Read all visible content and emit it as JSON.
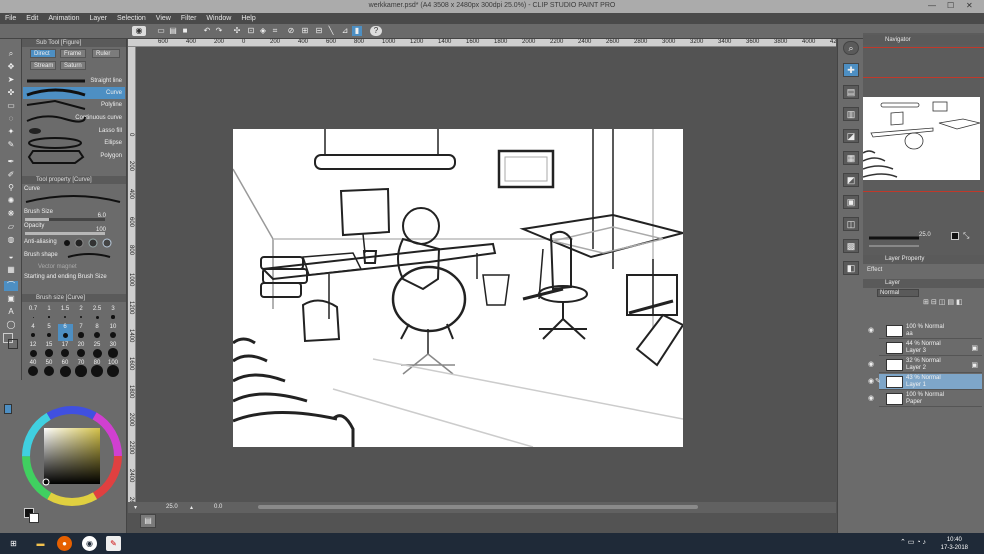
{
  "window": {
    "title": "werkkamer.psd* (A4 3508 x 2480px 300dpi 25.0%) - CLIP STUDIO PAINT PRO",
    "minimize": "—",
    "maximize": "☐",
    "close": "✕"
  },
  "menu": [
    "File",
    "Edit",
    "Animation",
    "Layer",
    "Selection",
    "View",
    "Filter",
    "Window",
    "Help"
  ],
  "ruler": {
    "h_ticks": [
      "600",
      "400",
      "200",
      "0",
      "200",
      "400",
      "600",
      "800",
      "1000",
      "1200",
      "1400",
      "1600",
      "1800",
      "2000",
      "2200",
      "2400",
      "2600",
      "2800",
      "3000",
      "3200",
      "3400",
      "3600",
      "3800",
      "4000",
      "4200"
    ],
    "v_ticks": [
      "0",
      "200",
      "400",
      "600",
      "800",
      "1000",
      "1200",
      "1400",
      "1600",
      "1800",
      "2000",
      "2200",
      "2400",
      "2600"
    ]
  },
  "subtool": {
    "header": "Sub Tool [Figure]",
    "tabs": [
      "Direct",
      "Frame",
      "Ruler",
      "Stream",
      "Saturn"
    ],
    "brushes": [
      "Straight line",
      "Curve",
      "Polyline",
      "Continuous curve",
      "Lasso fill",
      "Ellipse",
      "Polygon"
    ],
    "selected": "Curve"
  },
  "toolprop": {
    "header": "Tool property [Curve]",
    "name": "Curve",
    "brush_size_label": "Brush Size",
    "brush_size_value": "6.0",
    "brush_size_level": 0.3,
    "opacity_label": "Opacity",
    "opacity_value": "100",
    "opacity_level": 1.0,
    "antialiasing_label": "Anti-aliasing",
    "brush_shape_label": "Brush shape",
    "vector_label": "Vector magnet",
    "start_end_label": "Starting and ending",
    "start_end_value": "Brush Size"
  },
  "brushsize": {
    "header": "Brush size [Curve]",
    "sizes": [
      "0.7",
      "1",
      "1.5",
      "2",
      "2.5",
      "3",
      "4",
      "5",
      "6",
      "7",
      "8",
      "10",
      "12",
      "15",
      "17",
      "20",
      "25",
      "30",
      "40",
      "50",
      "60",
      "70",
      "80",
      "100"
    ]
  },
  "colors": {
    "main": "#111111",
    "sub": "#ffffff",
    "picker_hue": "#cfc25a",
    "accent": "#4d8fc3"
  },
  "statusbar": {
    "zoom": "25.0",
    "rotation": "0.0"
  },
  "navigator": {
    "tab": "Navigator"
  },
  "stroke_preview": {
    "value": "25.0"
  },
  "layer_property": {
    "tab": "Layer Property",
    "effect_label": "Effect"
  },
  "layers_panel": {
    "tab": "Layer",
    "blend": "Normal",
    "layers": [
      {
        "name": "aa",
        "mode": "100 % Normal",
        "locked": true
      },
      {
        "name": "Layer 3",
        "mode": "44 % Normal",
        "locked": true
      },
      {
        "name": "Layer 2",
        "mode": "32 % Normal",
        "locked": true
      },
      {
        "name": "Layer 1",
        "mode": "43 % Normal",
        "locked": false,
        "selected": true
      },
      {
        "name": "Paper",
        "mode": "100 % Normal",
        "locked": false
      }
    ]
  },
  "taskbar": {
    "time": "10:40",
    "date": "17-3-2018"
  }
}
